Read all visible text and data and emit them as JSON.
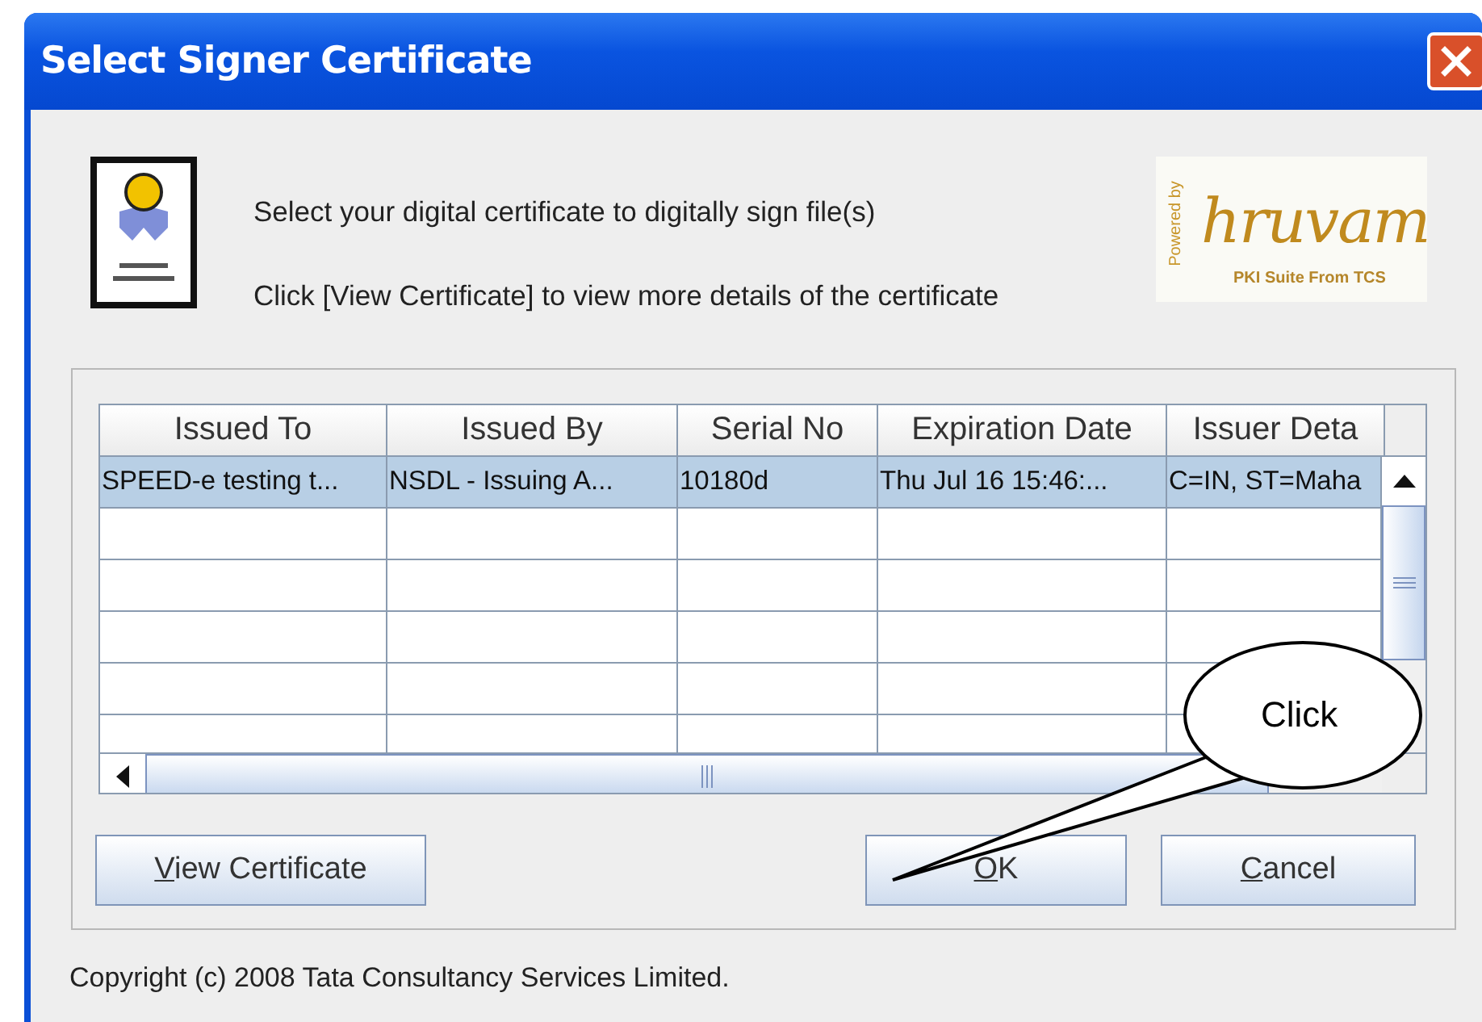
{
  "window": {
    "title": "Select Signer Certificate"
  },
  "intro": [
    "Select your digital certificate to digitally sign file(s)",
    "Click [View Certificate] to view more details of the certificate"
  ],
  "logo": {
    "powered_by": "Powered by",
    "name": "hruvam",
    "tagline": "PKI Suite From TCS"
  },
  "table": {
    "columns": [
      "Issued To",
      "Issued By",
      "Serial No",
      "Expiration Date",
      "Issuer Deta"
    ],
    "rows": [
      {
        "cells": [
          "SPEED-e testing t...",
          "NSDL - Issuing A...",
          "10180d",
          "Thu Jul 16 15:46:...",
          "C=IN, ST=Maha"
        ],
        "selected": true
      }
    ]
  },
  "buttons": [
    {
      "label": "View Certificate",
      "underline_first": true,
      "kind": "left"
    },
    {
      "label": "OK",
      "underline_first": true,
      "kind": "right"
    },
    {
      "label": "Cancel",
      "underline_first": true,
      "kind": "right"
    }
  ],
  "copyright": "Copyright (c) 2008 Tata Consultancy Services Limited.",
  "annotation": {
    "text": "Click"
  }
}
